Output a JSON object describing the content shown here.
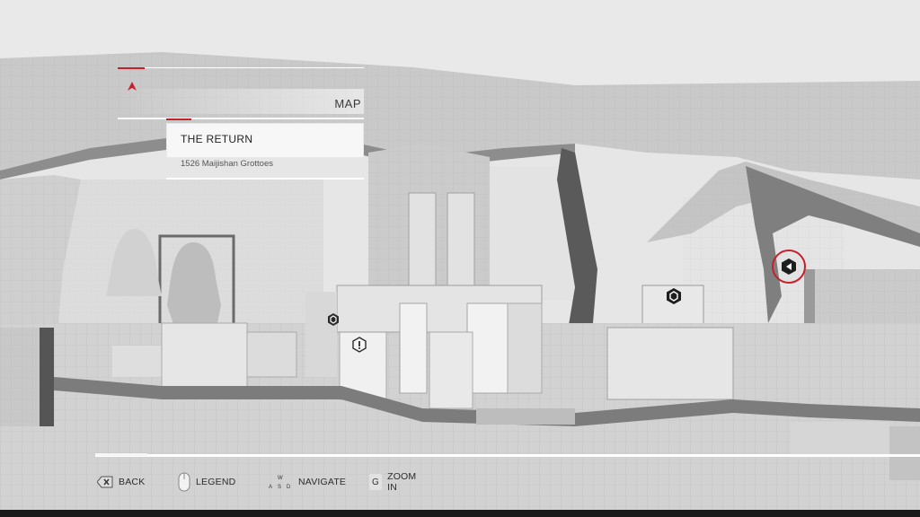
{
  "header": {
    "title": "MAP"
  },
  "mission": {
    "name": "THE RETURN",
    "location": "1526 Maijishan Grottoes"
  },
  "controls": {
    "back": "BACK",
    "legend": "LEGEND",
    "navigate": "NAVIGATE",
    "zoom_key": "G",
    "zoom": "ZOOM IN",
    "wasd": [
      "W",
      "A",
      "S",
      "D"
    ]
  },
  "map_markers": [
    "hex-marker-left",
    "alert-marker",
    "hex-marker-center",
    "selected-marker"
  ],
  "colors": {
    "accent_red": "#c8202a",
    "marker_dark": "#2a2a2a"
  }
}
